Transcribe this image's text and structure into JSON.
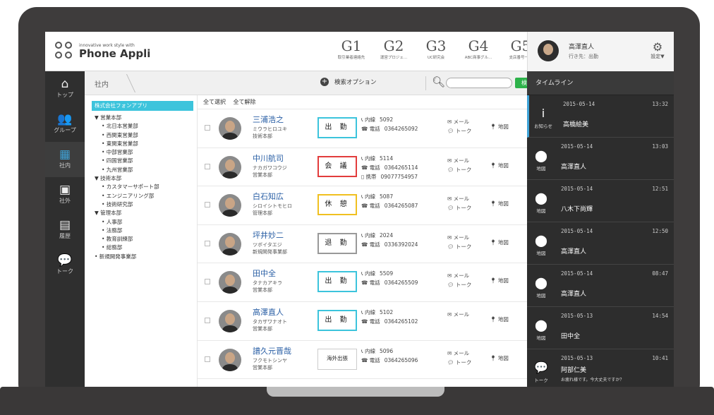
{
  "header": {
    "logo_tagline": "innovative work style with",
    "logo_name": "Phone Appli",
    "groups": [
      {
        "key": "G1",
        "label": "取引業者連絡先"
      },
      {
        "key": "G2",
        "label": "運営プロジェ..."
      },
      {
        "key": "G3",
        "label": "UC研究会"
      },
      {
        "key": "G4",
        "label": "ABC商事グル..."
      },
      {
        "key": "G5",
        "label": "支店番号一覧"
      }
    ],
    "user_name": "高澤直人",
    "user_status": "行き先：出勤",
    "settings_label": "設定▼"
  },
  "nav": [
    {
      "icon": "⌂",
      "label": "トップ"
    },
    {
      "icon": "👥",
      "label": "グループ"
    },
    {
      "icon": "▦",
      "label": "社内"
    },
    {
      "icon": "▣",
      "label": "社外"
    },
    {
      "icon": "▤",
      "label": "履歴"
    },
    {
      "icon": "💬",
      "label": "トーク"
    }
  ],
  "toolbar": {
    "breadcrumb": "社内",
    "search_options": "検索オプション",
    "search_placeholder": "",
    "search_button": "検索"
  },
  "org": {
    "root": "株式会社フォンアプリ",
    "nodes": [
      {
        "level": 1,
        "label": "▼ 営業本部"
      },
      {
        "level": 2,
        "label": "• 北日本営業部"
      },
      {
        "level": 2,
        "label": "• 西関東営業部"
      },
      {
        "level": 2,
        "label": "• 東関東営業部"
      },
      {
        "level": 2,
        "label": "• 中部営業部"
      },
      {
        "level": 2,
        "label": "• 四国営業部"
      },
      {
        "level": 2,
        "label": "• 九州営業部"
      },
      {
        "level": 1,
        "label": "▼ 技術本部"
      },
      {
        "level": 2,
        "label": "• カスタマーサポート部"
      },
      {
        "level": 2,
        "label": "• エンジニアリング部"
      },
      {
        "level": 2,
        "label": "• 技術研究部"
      },
      {
        "level": 1,
        "label": "▼ 管理本部"
      },
      {
        "level": 2,
        "label": "• 人事部"
      },
      {
        "level": 2,
        "label": "• 法務部"
      },
      {
        "level": 2,
        "label": "• 教育訓練部"
      },
      {
        "level": 2,
        "label": "• 総務部"
      },
      {
        "level": 1,
        "label": "• 新規開発事業部"
      }
    ]
  },
  "list": {
    "select_all": "全て選択",
    "deselect_all": "全て解除",
    "ext_label": "内線",
    "tel_label": "電話",
    "mobile_label": "携帯",
    "mail_label": "メール",
    "talk_label": "トーク",
    "map_label": "地図",
    "rows": [
      {
        "name": "三浦浩之",
        "kana": "ミウラヒロユキ",
        "dept": "技術本部",
        "status": "出 勤",
        "status_type": "in",
        "ext": "5092",
        "tel": "0364265092",
        "mobile": "",
        "talk": true,
        "map": true
      },
      {
        "name": "中川航司",
        "kana": "ナカガワコウジ",
        "dept": "営業本部",
        "status": "会 議",
        "status_type": "meeting",
        "ext": "5114",
        "tel": "0364265114",
        "mobile": "09077754957",
        "talk": true,
        "map": true
      },
      {
        "name": "白石知広",
        "kana": "シロイシトモヒロ",
        "dept": "管理本部",
        "status": "休 憩",
        "status_type": "break",
        "ext": "5087",
        "tel": "0364265087",
        "mobile": "",
        "talk": true,
        "map": true
      },
      {
        "name": "坪井妙二",
        "kana": "ツボイタエジ",
        "dept": "新規開発事業部",
        "status": "退 勤",
        "status_type": "leave",
        "ext": "2024",
        "tel": "0336392024",
        "mobile": "",
        "talk": true,
        "map": true
      },
      {
        "name": "田中全",
        "kana": "タナカアキラ",
        "dept": "営業本部",
        "status": "出 勤",
        "status_type": "in",
        "ext": "5509",
        "tel": "0364265509",
        "mobile": "",
        "talk": true,
        "map": true
      },
      {
        "name": "高澤直人",
        "kana": "タカザワナオト",
        "dept": "営業本部",
        "status": "出 勤",
        "status_type": "in",
        "ext": "5102",
        "tel": "0364265102",
        "mobile": "",
        "talk": false,
        "map": true
      },
      {
        "name": "譜久元晋哉",
        "kana": "フクモトシンヤ",
        "dept": "営業本部",
        "status": "海外出張",
        "status_type": "trip",
        "ext": "5096",
        "tel": "0364265096",
        "mobile": "",
        "talk": true,
        "map": true
      }
    ]
  },
  "timeline": {
    "title": "タイムライン",
    "items": [
      {
        "icon": "i",
        "icon_label": "お知らせ",
        "date": "2015-05-14",
        "time": "13:32",
        "name": "高橋絵美",
        "msg": ""
      },
      {
        "icon": "⬤",
        "icon_label": "地図",
        "date": "2015-05-14",
        "time": "13:03",
        "name": "高澤直人",
        "msg": ""
      },
      {
        "icon": "⬤",
        "icon_label": "地図",
        "date": "2015-05-14",
        "time": "12:51",
        "name": "八木下尚輝",
        "msg": ""
      },
      {
        "icon": "⬤",
        "icon_label": "地図",
        "date": "2015-05-14",
        "time": "12:50",
        "name": "高澤直人",
        "msg": ""
      },
      {
        "icon": "⬤",
        "icon_label": "地図",
        "date": "2015-05-14",
        "time": "08:47",
        "name": "高澤直人",
        "msg": ""
      },
      {
        "icon": "⬤",
        "icon_label": "地図",
        "date": "2015-05-13",
        "time": "14:54",
        "name": "田中全",
        "msg": ""
      },
      {
        "icon": "💬",
        "icon_label": "トーク",
        "date": "2015-05-13",
        "time": "10:41",
        "name": "阿部仁美",
        "msg": "お疲れ様です。今大丈夫ですか？"
      }
    ]
  },
  "colors": {
    "accent": "#3cc4dc",
    "meeting": "#e23c3c",
    "break": "#f0c020",
    "search_green": "#2db24a",
    "link_blue": "#2a5fa5"
  }
}
